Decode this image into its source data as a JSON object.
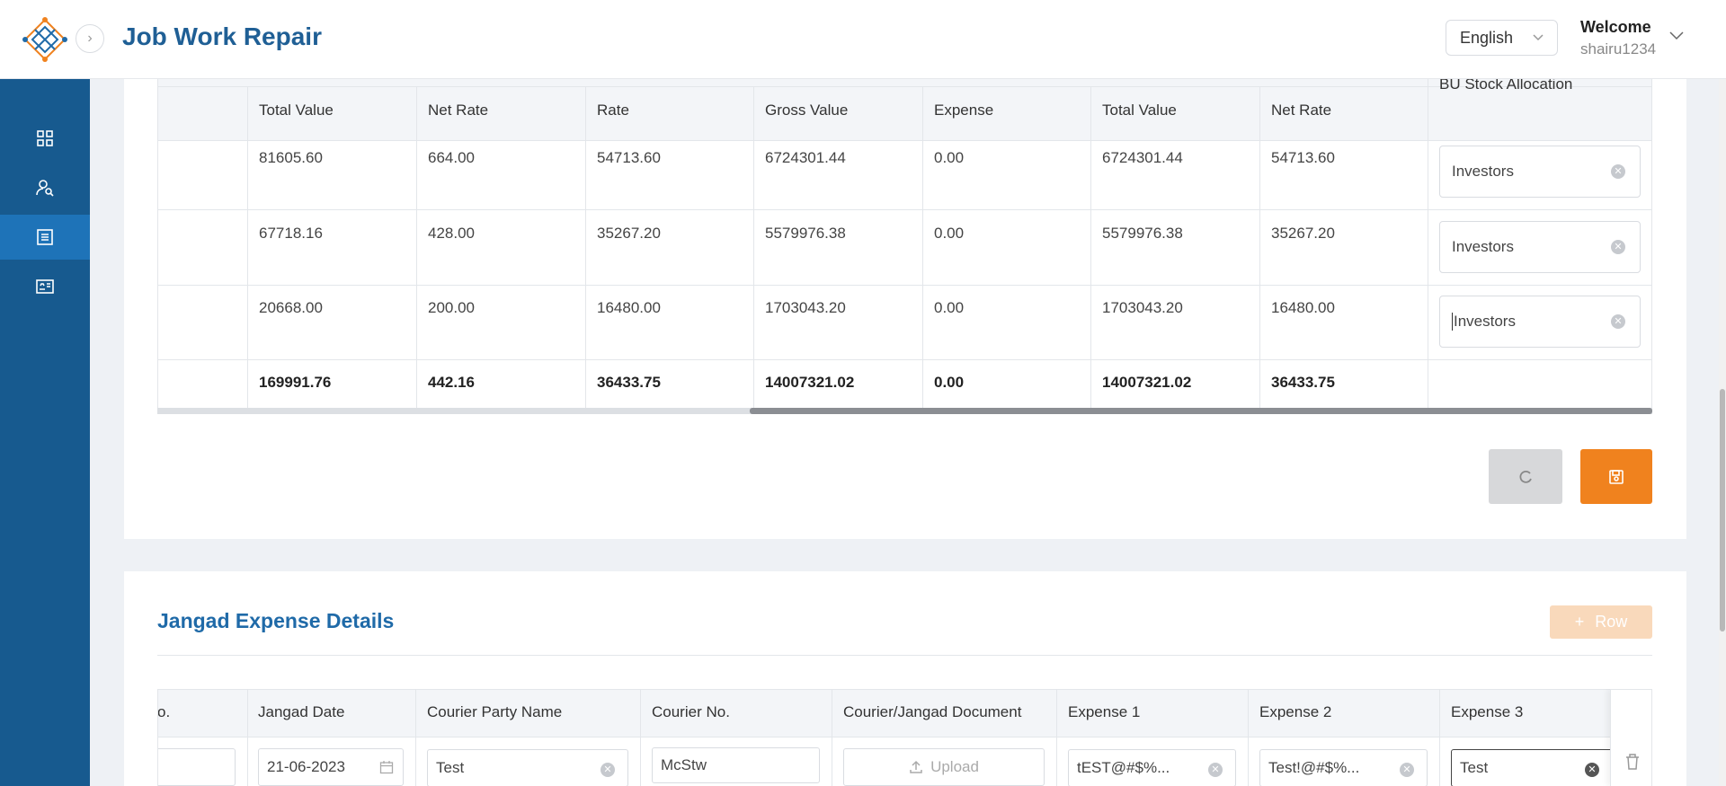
{
  "header": {
    "title": "Job Work Repair",
    "language": "English",
    "welcome": "Welcome",
    "username": "shairu1234"
  },
  "sidebar": {
    "items": [
      {
        "icon": "dashboard-icon",
        "active": false
      },
      {
        "icon": "user-search-icon",
        "active": false
      },
      {
        "icon": "list-document-icon",
        "active": true
      },
      {
        "icon": "id-card-icon",
        "active": false
      }
    ]
  },
  "stock_table": {
    "headers": [
      "Total Value",
      "Net Rate",
      "Rate",
      "Gross Value",
      "Expense",
      "Total Value",
      "Net Rate"
    ],
    "bu_header": "BU Stock Allocation",
    "rows": [
      {
        "cells": [
          "81605.60",
          "664.00",
          "54713.60",
          "6724301.44",
          "0.00",
          "6724301.44",
          "54713.60"
        ],
        "bu": "Investors"
      },
      {
        "cells": [
          "67718.16",
          "428.00",
          "35267.20",
          "5579976.38",
          "0.00",
          "5579976.38",
          "35267.20"
        ],
        "bu": "Investors"
      },
      {
        "cells": [
          "20668.00",
          "200.00",
          "16480.00",
          "1703043.20",
          "0.00",
          "1703043.20",
          "16480.00"
        ],
        "bu": "Investors"
      }
    ],
    "totals": [
      "169991.76",
      "442.16",
      "36433.75",
      "14007321.02",
      "0.00",
      "14007321.02",
      "36433.75"
    ]
  },
  "jangad": {
    "title": "Jangad Expense Details",
    "add_row_label": "Row",
    "headers": [
      "o.",
      "Jangad Date",
      "Courier Party Name",
      "Courier No.",
      "Courier/Jangad Document",
      "Expense 1",
      "Expense 2",
      "Expense 3"
    ],
    "row": {
      "date": "21-06-2023",
      "courier_party": "Test",
      "courier_no": "McStw",
      "upload_label": "Upload",
      "expense1": "tEST@#$%...",
      "expense2": "Test!@#$%...",
      "expense3": "Test"
    }
  },
  "colors": {
    "brand": "#1f5f95",
    "sidebar": "#175a8f",
    "save": "#f0821e"
  }
}
